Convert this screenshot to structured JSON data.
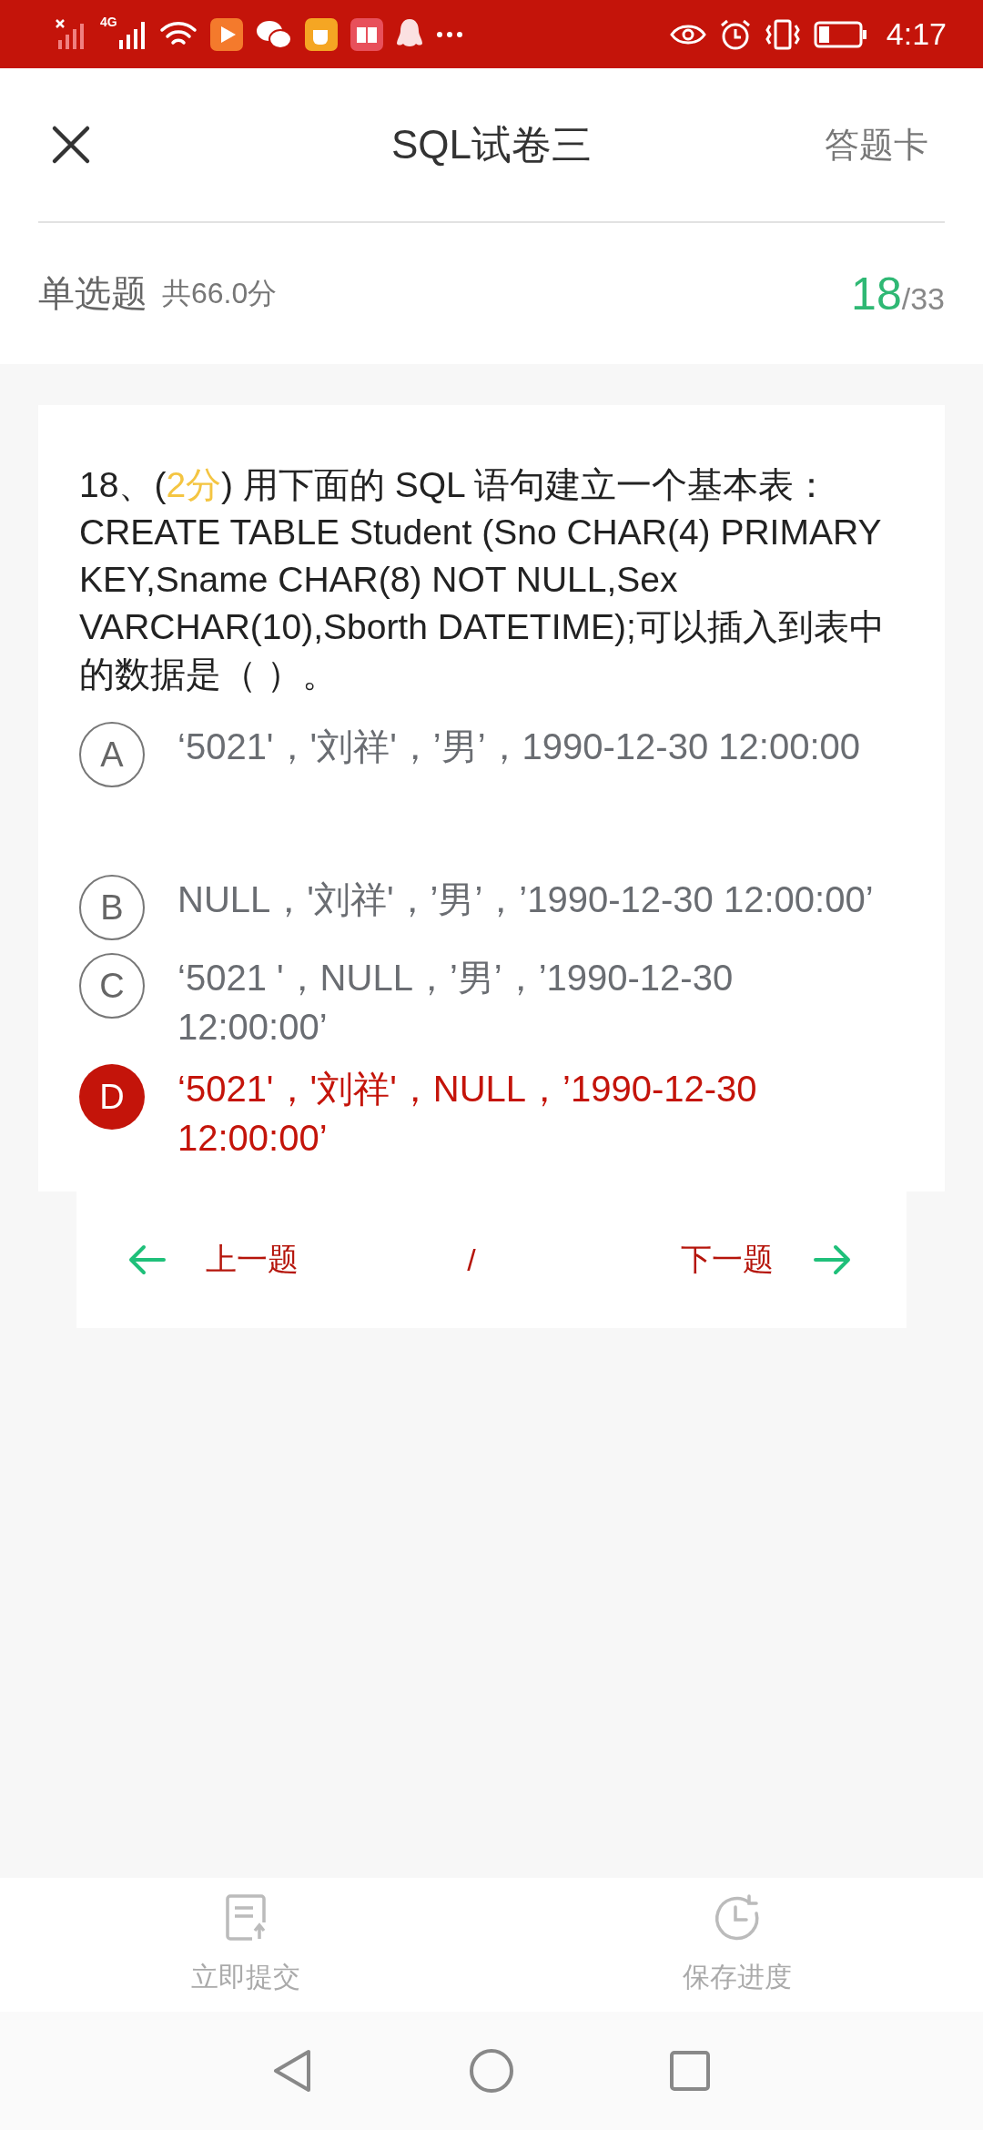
{
  "status_bar": {
    "network": "4G",
    "time": "4:17"
  },
  "header": {
    "title": "SQL试卷三",
    "answer_card": "答题卡"
  },
  "section": {
    "type": "单选题",
    "score": "共66.0分",
    "current": "18",
    "total": "/33"
  },
  "question": {
    "prefix": "18、(",
    "points": "2分",
    "body": ") 用下面的 SQL 语句建立一个基本表：CREATE TABLE Student (Sno CHAR(4) PRIMARY KEY,Sname CHAR(8) NOT NULL,Sex VARCHAR(10),Sborth DATETIME);可以插入到表中的数据是（ ）。"
  },
  "options": [
    {
      "letter": "A",
      "text": "‘5021'，'刘祥'，’男’，1990-12-30 12:00:00",
      "selected": false
    },
    {
      "letter": "B",
      "text": "NULL，'刘祥'，’男’，’1990-12-30 12:00:00’",
      "selected": false
    },
    {
      "letter": "C",
      "text": "‘5021 '，NULL，’男’，’1990-12-30 12:00:00’",
      "selected": false
    },
    {
      "letter": "D",
      "text": "‘5021'，'刘祥'，NULL，’1990-12-30 12:00:00’",
      "selected": true
    }
  ],
  "nav": {
    "prev": "上一题",
    "separator": "/",
    "next": "下一题"
  },
  "actions": [
    {
      "kind": "submit",
      "label": "立即提交"
    },
    {
      "kind": "save",
      "label": "保存进度"
    }
  ]
}
